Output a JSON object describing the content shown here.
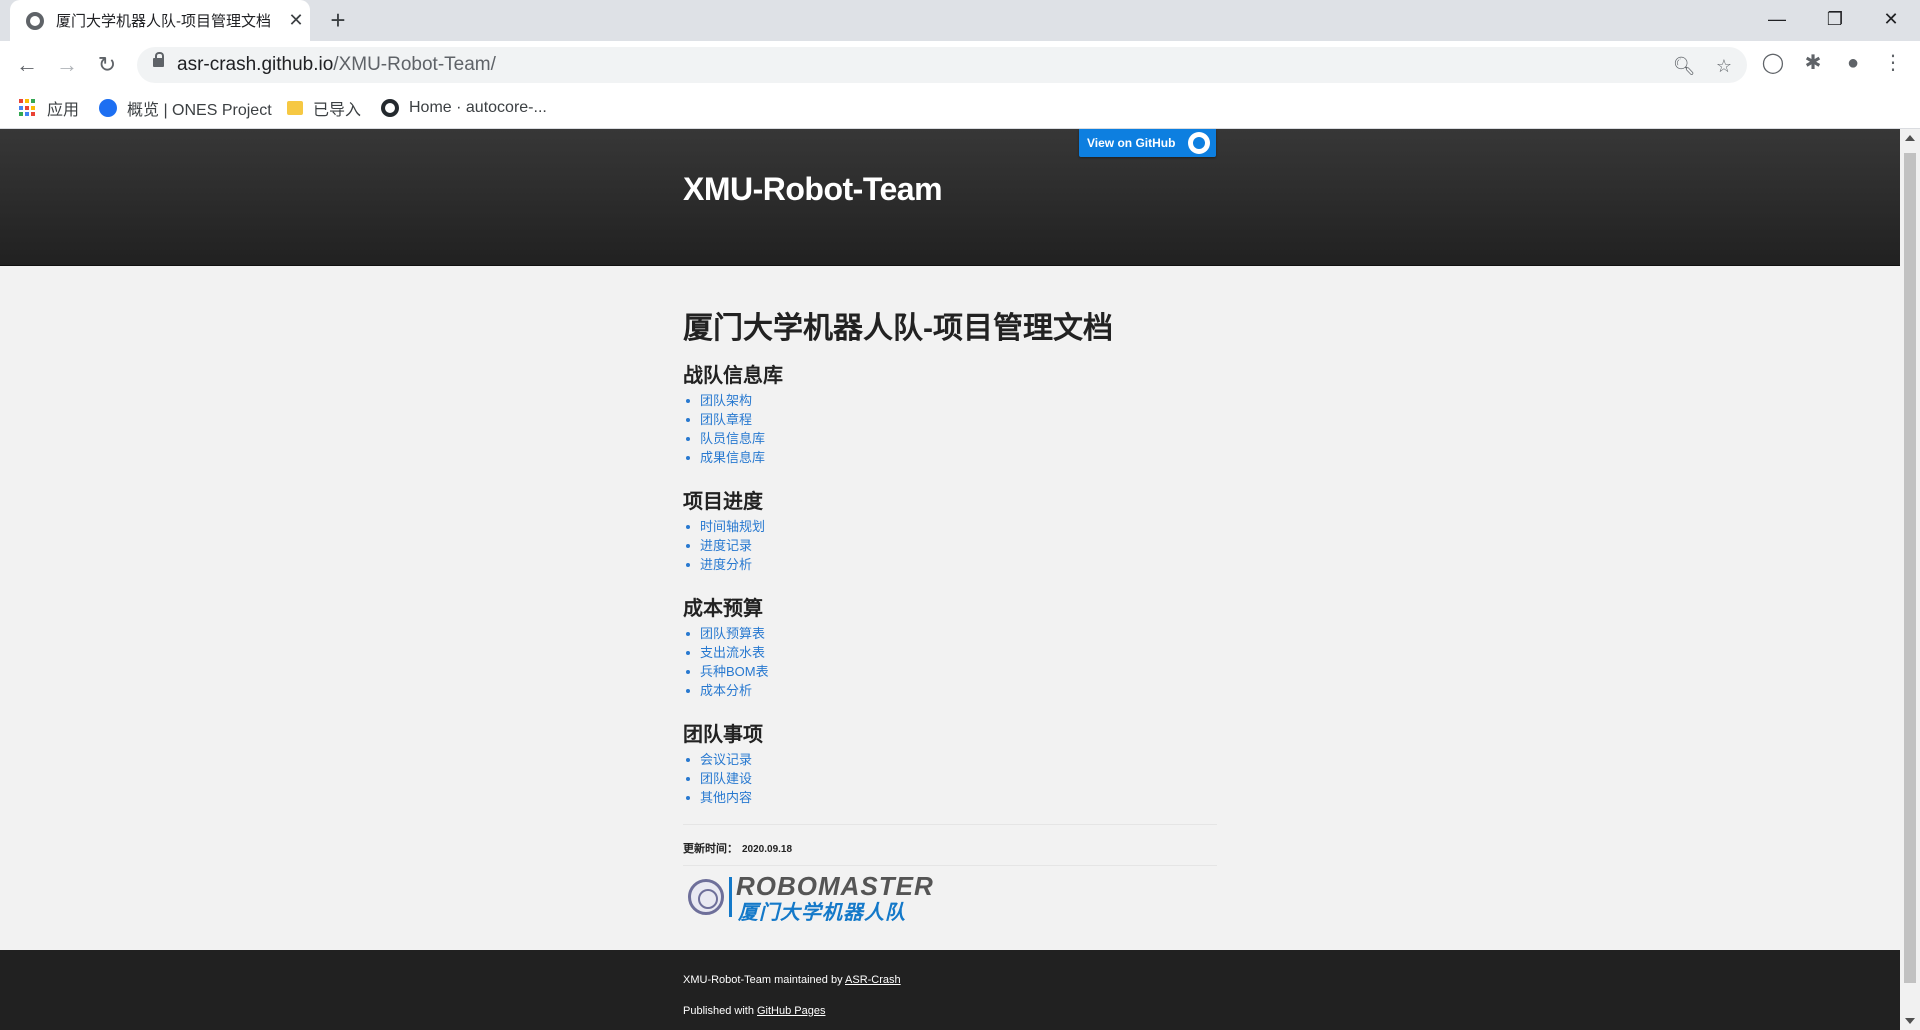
{
  "browser": {
    "tab_title": "厦门大学机器人队-项目管理文档",
    "url_host": "asr-crash.github.io",
    "url_path": "/XMU-Robot-Team/",
    "bookmarks": [
      {
        "label": "应用",
        "icon": "apps-grid-icon"
      },
      {
        "label": "概览 | ONES Project",
        "icon": "ones-icon"
      },
      {
        "label": "已导入",
        "icon": "folder-icon"
      },
      {
        "label": "Home · autocore-...",
        "icon": "github-icon"
      }
    ]
  },
  "site": {
    "title": "XMU-Robot-Team",
    "github_button": "View on GitHub"
  },
  "content": {
    "heading": "厦门大学机器人队-项目管理文档",
    "sections": [
      {
        "title": "战队信息库",
        "links": [
          "团队架构",
          "团队章程",
          "队员信息库",
          "成果信息库"
        ]
      },
      {
        "title": "项目进度",
        "links": [
          "时间轴规划",
          "进度记录",
          "进度分析"
        ]
      },
      {
        "title": "成本预算",
        "links": [
          "团队预算表",
          "支出流水表",
          "兵种BOM表",
          "成本分析"
        ]
      },
      {
        "title": "团队事项",
        "links": [
          "会议记录",
          "团队建设",
          "其他内容"
        ]
      }
    ],
    "update_label": "更新时间：",
    "update_date": "2020.09.18",
    "logo_text_en": "ROBOMASTER",
    "logo_text_cn": "厦门大学机器人队"
  },
  "footer": {
    "maintained_prefix": "XMU-Robot-Team maintained by ",
    "maintainer_link": "ASR-Crash",
    "published_prefix": "Published with ",
    "pages_link": "GitHub Pages"
  },
  "colors": {
    "link": "#2879d0",
    "header_bg": "#2b2b2b",
    "github_button": "#0d7fe0"
  }
}
